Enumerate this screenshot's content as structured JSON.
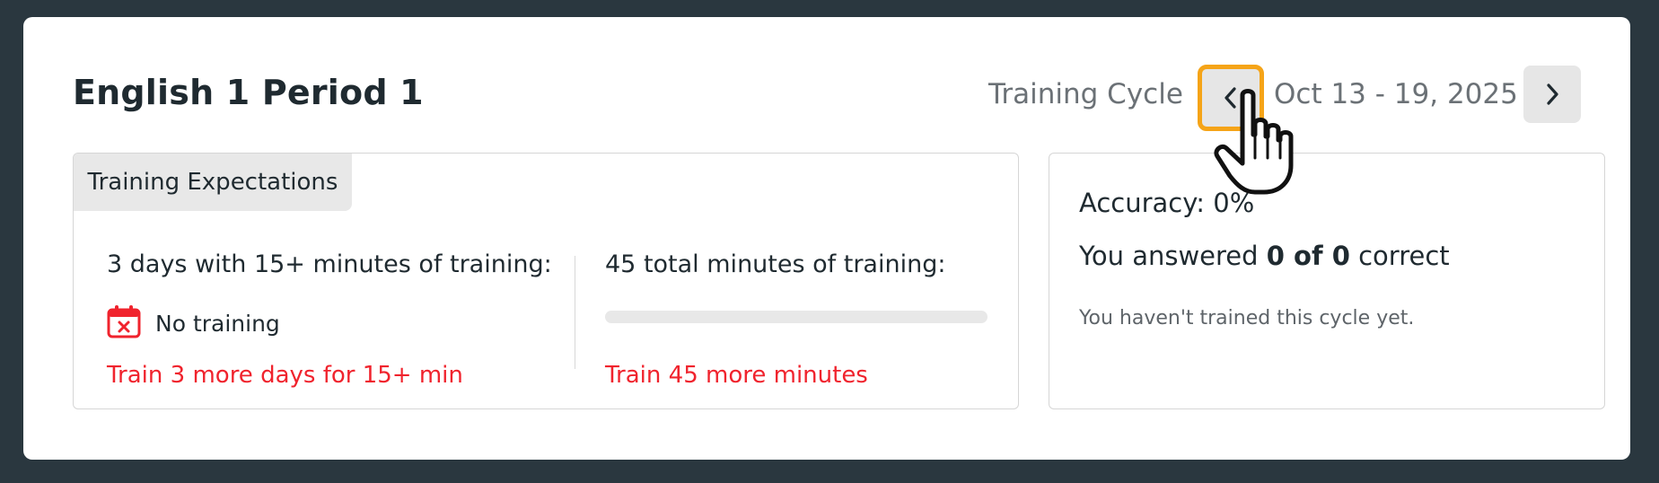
{
  "header": {
    "class_title": "English 1 Period 1",
    "cycle_label": "Training Cycle",
    "cycle_range": "Oct 13 - 19, 2025",
    "prev_icon": "chevron-left-icon",
    "next_icon": "chevron-right-icon"
  },
  "expectations": {
    "tab_label": "Training Expectations",
    "days_requirement": "3 days with 15+ minutes of training:",
    "days_status": "No training",
    "days_status_icon": "calendar-x-icon",
    "days_warning": "Train 3 more days for 15+ min",
    "minutes_requirement": "45 total minutes of training:",
    "minutes_progress": 0,
    "minutes_warning": "Train 45 more minutes"
  },
  "accuracy": {
    "title": "Accuracy: 0%",
    "answered_prefix": "You answered ",
    "answered_value": "0 of 0",
    "answered_suffix": " correct",
    "note": "You haven't trained this cycle yet."
  },
  "colors": {
    "background": "#2a373f",
    "warning": "#f0232d",
    "highlight": "#f5a418"
  }
}
